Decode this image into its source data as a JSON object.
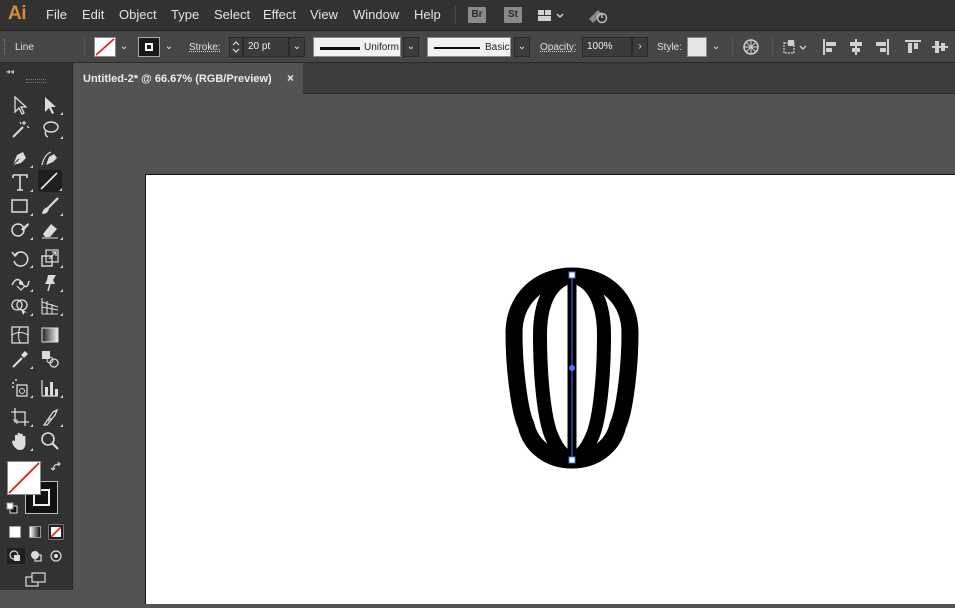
{
  "app": {
    "logo": "Ai"
  },
  "menu": [
    "File",
    "Edit",
    "Object",
    "Type",
    "Select",
    "Effect",
    "View",
    "Window",
    "Help"
  ],
  "app_badges": [
    "Br",
    "St"
  ],
  "control_bar": {
    "selection_label": "Line",
    "stroke_label": "Stroke:",
    "stroke_weight": "20 pt",
    "profile_label": "Uniform",
    "brush_label": "Basic",
    "opacity_label": "Opacity:",
    "opacity_value": "100%",
    "style_label": "Style:"
  },
  "document": {
    "tab_title": "Untitled-2* @ 66.67% (RGB/Preview)",
    "close_glyph": "×"
  },
  "colors": {
    "menu_bg": "#323232",
    "panel_bg": "#464646",
    "canvas_bg": "#535353",
    "artboard": "#ffffff",
    "selection": "#4a6cff",
    "logo": "#d98a3e"
  },
  "toolbox": {
    "tools": [
      "selection-tool",
      "direct-selection-tool",
      "magic-wand-tool",
      "lasso-tool",
      "pen-tool",
      "curvature-tool",
      "type-tool",
      "line-segment-tool",
      "rectangle-tool",
      "paintbrush-tool",
      "shaper-tool",
      "eraser-tool",
      "rotate-tool",
      "scale-tool",
      "width-tool",
      "puppet-warp-tool",
      "shape-builder-tool",
      "perspective-grid-tool",
      "mesh-tool",
      "gradient-tool",
      "eyedropper-tool",
      "blend-tool",
      "symbol-sprayer-tool",
      "column-graph-tool",
      "artboard-tool",
      "slice-tool",
      "hand-tool",
      "zoom-tool"
    ],
    "active_tool": "line-segment-tool"
  }
}
